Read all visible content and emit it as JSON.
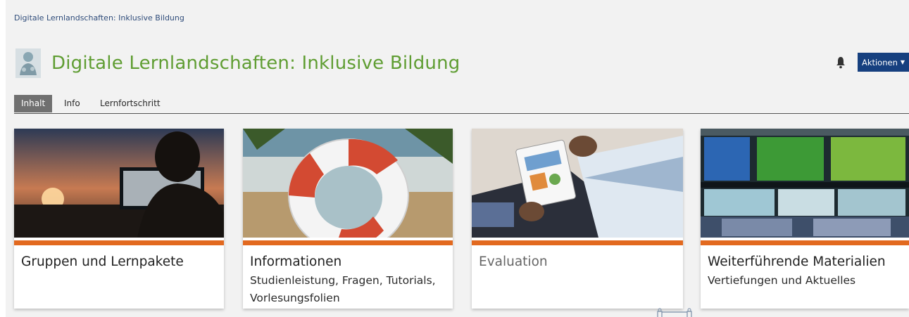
{
  "breadcrumb": "Digitale Lernlandschaften: Inklusive Bildung",
  "header": {
    "title": "Digitale Lernlandschaften: Inklusive Bildung",
    "logo_icon": "course-logo-icon",
    "notification_icon": "bell-icon",
    "actions_label": "Aktionen"
  },
  "tabs": [
    {
      "label": "Inhalt",
      "active": true
    },
    {
      "label": "Info",
      "active": false
    },
    {
      "label": "Lernfortschritt",
      "active": false
    }
  ],
  "tiles": [
    {
      "title": "Gruppen und Lernpakete",
      "subtitle": ""
    },
    {
      "title": "Informationen",
      "subtitle": "Studienleistung, Fragen, Tutorials, Vorlesungsfolien"
    },
    {
      "title": "Evaluation",
      "subtitle": ""
    },
    {
      "title": "Weiterführende Materialien",
      "subtitle": "Vertiefungen und Aktuelles"
    }
  ],
  "colors": {
    "title_green": "#5f9d32",
    "actions_blue": "#16407f",
    "tile_stripe_orange": "#e2691f"
  }
}
